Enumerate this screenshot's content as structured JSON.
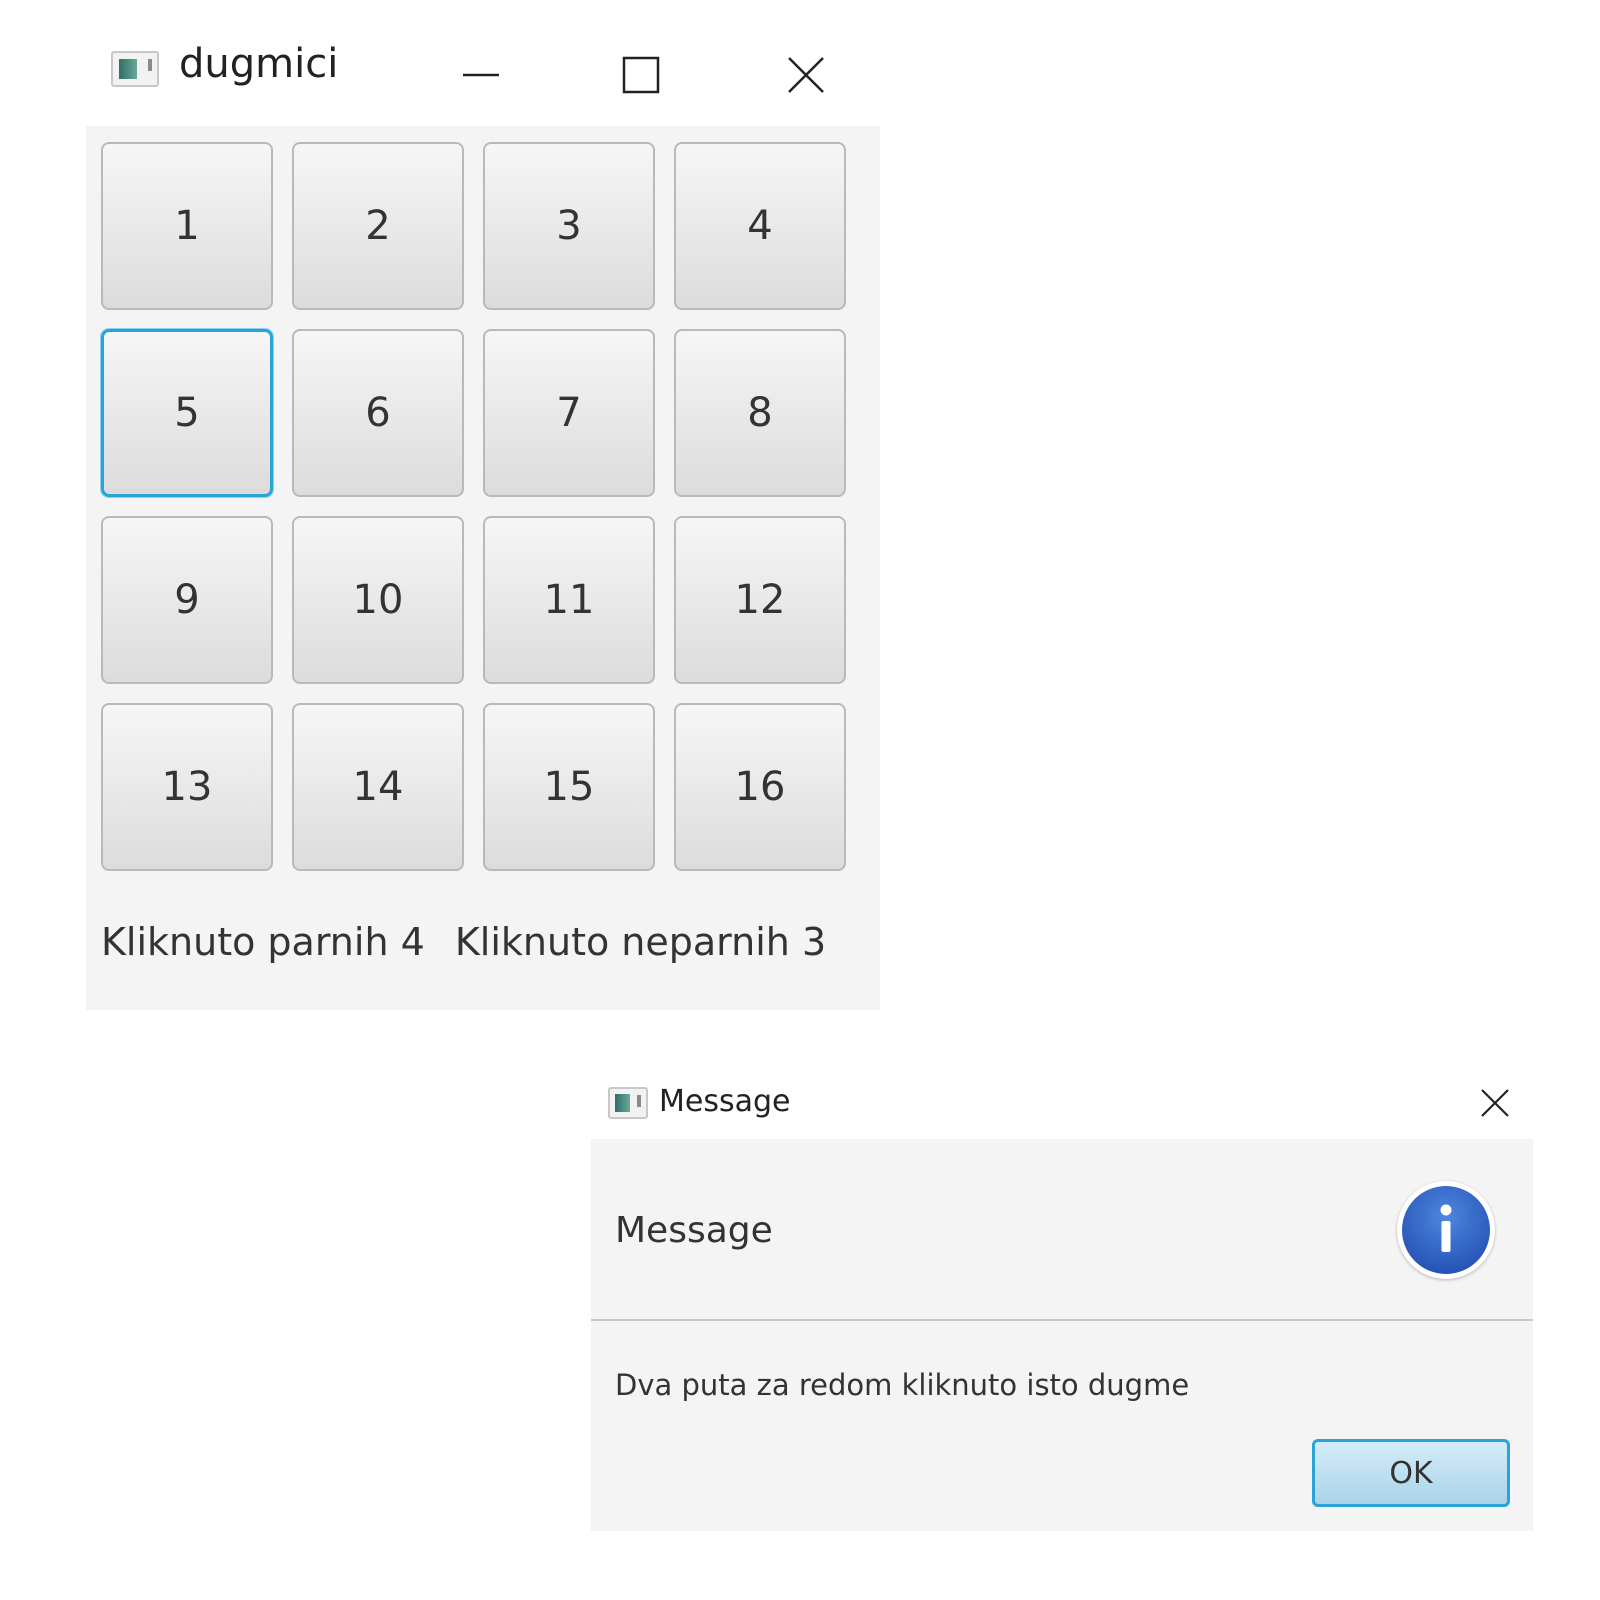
{
  "main_window": {
    "title": "dugmici",
    "buttons": [
      "1",
      "2",
      "3",
      "4",
      "5",
      "6",
      "7",
      "8",
      "9",
      "10",
      "11",
      "12",
      "13",
      "14",
      "15",
      "16"
    ],
    "focused_button": "5",
    "status": {
      "even_clicks": "Kliknuto parnih 4",
      "odd_clicks": "Kliknuto neparnih 3"
    }
  },
  "dialog": {
    "title": "Message",
    "heading": "Message",
    "content": "Dva puta za redom kliknuto isto dugme",
    "ok_label": "OK",
    "icon": "info-icon"
  },
  "colors": {
    "focus_border": "#2aa3d8",
    "info_blue": "#2e62c6",
    "window_background": "#f4f4f4"
  }
}
